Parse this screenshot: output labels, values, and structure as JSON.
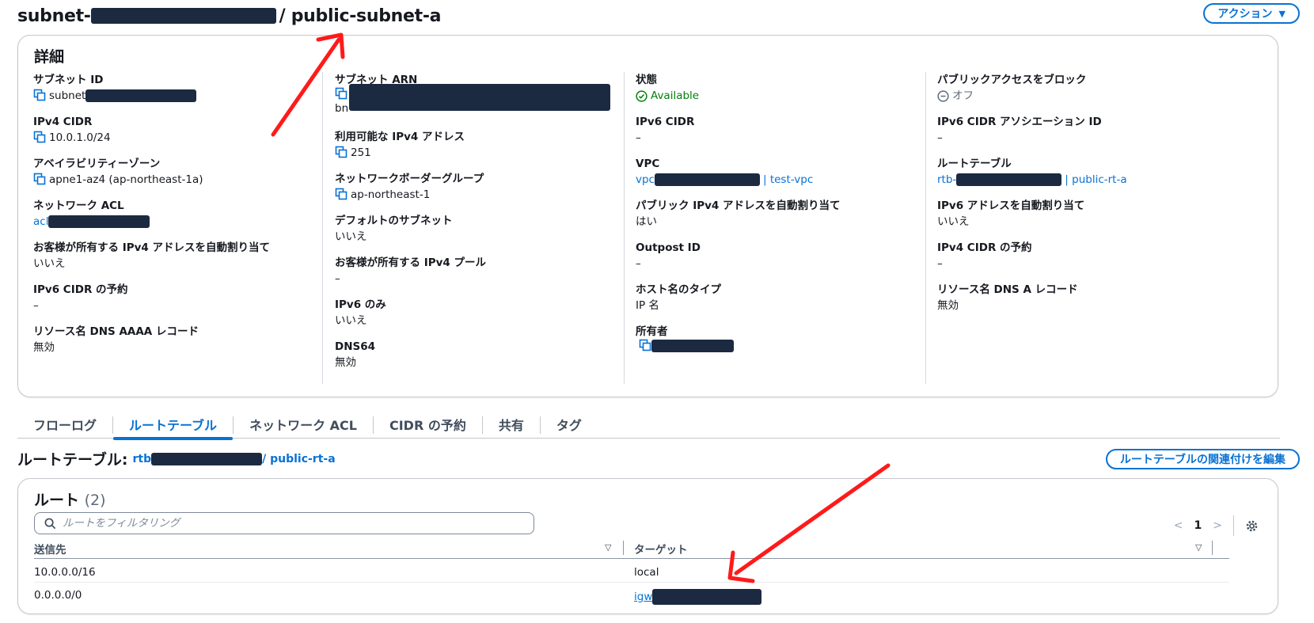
{
  "header": {
    "title_prefix": "subnet-",
    "title_suffix": "/ public-subnet-a",
    "action_label": "アクション"
  },
  "details": {
    "title": "詳細",
    "col1": [
      {
        "label": "サブネット ID",
        "value": "subnet"
      },
      {
        "label": "IPv4 CIDR",
        "value": "10.0.1.0/24"
      },
      {
        "label": "アベイラビリティーゾーン",
        "value": "apne1-az4 (ap-northeast-1a)"
      },
      {
        "label": "ネットワーク ACL",
        "value": "acl"
      },
      {
        "label": "お客様が所有する IPv4 アドレスを自動割り当て",
        "value": "いいえ"
      },
      {
        "label": "IPv6 CIDR の予約",
        "value": "–"
      },
      {
        "label": "リソース名 DNS AAAA レコード",
        "value": "無効"
      }
    ],
    "col2": [
      {
        "label": "サブネット ARN",
        "value": "bn"
      },
      {
        "label": "利用可能な IPv4 アドレス",
        "value": "251"
      },
      {
        "label": "ネットワークボーダーグループ",
        "value": "ap-northeast-1"
      },
      {
        "label": "デフォルトのサブネット",
        "value": "いいえ"
      },
      {
        "label": "お客様が所有する IPv4 プール",
        "value": "–"
      },
      {
        "label": "IPv6 のみ",
        "value": "いいえ"
      },
      {
        "label": "DNS64",
        "value": "無効"
      }
    ],
    "col3": [
      {
        "label": "状態",
        "value": "Available"
      },
      {
        "label": "IPv6 CIDR",
        "value": "–"
      },
      {
        "label": "VPC",
        "value": "vpc",
        "suffix": "| test-vpc"
      },
      {
        "label": "パブリック IPv4 アドレスを自動割り当て",
        "value": "はい"
      },
      {
        "label": "Outpost ID",
        "value": "–"
      },
      {
        "label": "ホスト名のタイプ",
        "value": "IP 名"
      },
      {
        "label": "所有者",
        "value": ""
      }
    ],
    "col4": [
      {
        "label": "パブリックアクセスをブロック",
        "value": "オフ"
      },
      {
        "label": "IPv6 CIDR アソシエーション ID",
        "value": "–"
      },
      {
        "label": "ルートテーブル",
        "value": "rtb-",
        "suffix": "| public-rt-a"
      },
      {
        "label": "IPv6 アドレスを自動割り当て",
        "value": "いいえ"
      },
      {
        "label": "IPv4 CIDR の予約",
        "value": "–"
      },
      {
        "label": "リソース名 DNS A レコード",
        "value": "無効"
      }
    ]
  },
  "tabs": [
    "フローログ",
    "ルートテーブル",
    "ネットワーク ACL",
    "CIDR の予約",
    "共有",
    "タグ"
  ],
  "route_table": {
    "label": "ルートテーブル:",
    "id_prefix": "rtb",
    "name": "/ public-rt-a",
    "edit_label": "ルートテーブルの関連付けを編集"
  },
  "routes": {
    "title": "ルート",
    "count": "(2)",
    "filter_placeholder": "ルートをフィルタリング",
    "page": "1",
    "col_destination": "送信先",
    "col_target": "ターゲット",
    "rows": [
      {
        "destination": "10.0.0.0/16",
        "target": "local"
      },
      {
        "destination": "0.0.0.0/0",
        "target": "igw"
      }
    ]
  },
  "colors": {
    "link": "#0972d3",
    "success": "#037f0c",
    "annotation_arrow": "#ff1a1a"
  }
}
